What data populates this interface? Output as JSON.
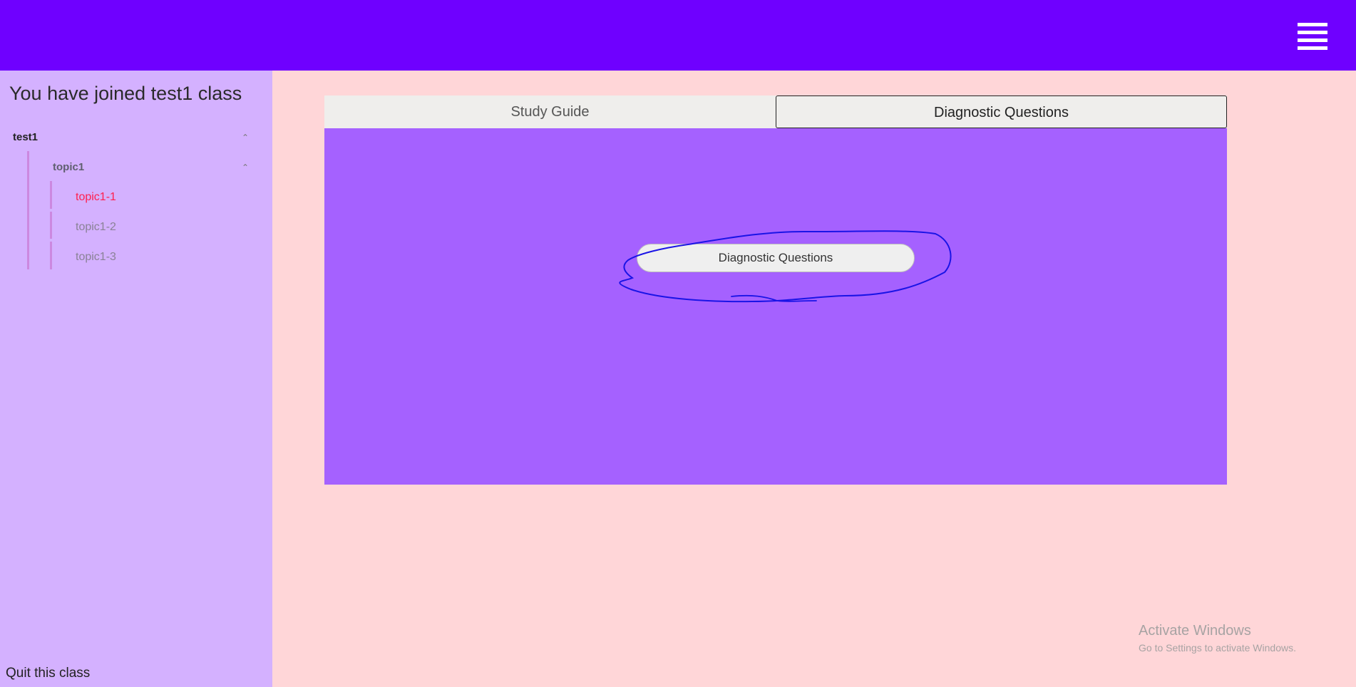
{
  "header": {
    "menu_icon": "hamburger-menu-icon",
    "background": "#6f00ff"
  },
  "sidebar": {
    "title": "You have joined test1 class",
    "tree": {
      "class_label": "test1",
      "topic_label": "topic1",
      "subtopics": [
        {
          "label": "topic1-1",
          "selected": true
        },
        {
          "label": "topic1-2",
          "selected": false
        },
        {
          "label": "topic1-3",
          "selected": false
        }
      ],
      "expand_icon": "chevron-up-icon"
    },
    "quit_label": "Quit this class"
  },
  "main": {
    "tabs": [
      {
        "label": "Study Guide",
        "active": false
      },
      {
        "label": "Diagnostic Questions",
        "active": true
      }
    ],
    "diagnostic_button_label": "Diagnostic Questions"
  },
  "watermark": {
    "title": "Activate Windows",
    "subtitle": "Go to Settings to activate Windows."
  },
  "colors": {
    "accent": "#6f00ff",
    "sidebar_bg": "#d4b1ff",
    "page_bg": "#ffd6d8",
    "panel_bg": "#a561ff",
    "selected_item": "#ff1f4e",
    "annotation_stroke": "#1a14e6"
  }
}
